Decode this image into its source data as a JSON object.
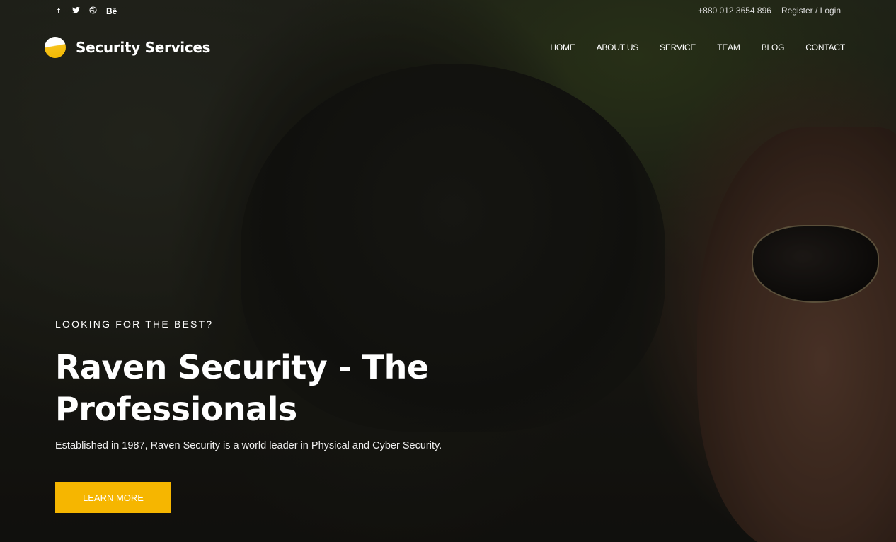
{
  "topbar": {
    "social": [
      "facebook-icon",
      "twitter-icon",
      "dribbble-icon",
      "behance-icon"
    ],
    "social_glyphs": {
      "facebook": "f",
      "twitter": "🐦",
      "dribbble": "⊛",
      "behance": "Bē"
    },
    "phone": "+880 012 3654 896",
    "auth_link": "Register / Login"
  },
  "header": {
    "logo_text": "Security Services",
    "nav": [
      {
        "label": "HOME"
      },
      {
        "label": "ABOUT US"
      },
      {
        "label": "SERVICE"
      },
      {
        "label": "TEAM"
      },
      {
        "label": "BLOG"
      },
      {
        "label": "CONTACT"
      }
    ]
  },
  "hero": {
    "eyebrow": "LOOKING FOR THE BEST?",
    "title_line1": "Raven Security - The",
    "title_line2": "Professionals",
    "description": "Established in 1987, Raven Security is a world leader in Physical and Cyber Security.",
    "cta_label": "LEARN MORE"
  },
  "colors": {
    "accent": "#f6b600",
    "text": "#ffffff"
  }
}
